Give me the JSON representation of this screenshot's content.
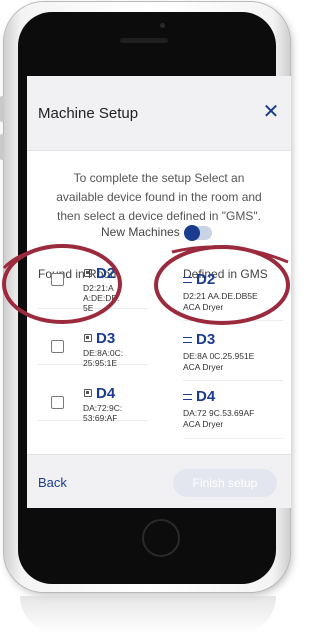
{
  "dialog": {
    "title": "Machine Setup",
    "close_glyph": "✕",
    "instructions": "To complete the setup Select an available device found in the room and then select a device defined in \"GMS\".",
    "new_machines_label": "New Machines",
    "new_machines_toggle": false
  },
  "columns": {
    "found_in_room": "Found in Room",
    "defined_in_gms": "Defined in GMS"
  },
  "found_devices": [
    {
      "name": "D2",
      "mac_lines": [
        "D2:21:A",
        "A:DE:DB:",
        "5E"
      ],
      "checked": false
    },
    {
      "name": "D3",
      "mac_lines": [
        "DE:8A:0C:",
        "25:95:1E"
      ],
      "checked": false
    },
    {
      "name": "D4",
      "mac_lines": [
        "DA:72:9C:",
        "53:69:AF"
      ],
      "checked": false
    }
  ],
  "gms_devices": [
    {
      "name": "D2",
      "mac": "D2:21 AA.DE.DB5E",
      "type": "ACA Dryer"
    },
    {
      "name": "D3",
      "mac": "DE:8A 0C.25.951E",
      "type": "ACA Dryer"
    },
    {
      "name": "D4",
      "mac": "DA:72 9C.53.69AF",
      "type": "ACA Dryer"
    }
  ],
  "footer": {
    "back_label": "Back",
    "finish_label": "Finish setup",
    "finish_enabled": false
  },
  "colors": {
    "accent": "#1b3c8e",
    "highlight_ellipse": "#9b2a3c",
    "header_bg": "#f1f1f4"
  },
  "icons": {
    "close": "close-icon",
    "device": "device-icon",
    "gms_device": "equals-icon"
  }
}
